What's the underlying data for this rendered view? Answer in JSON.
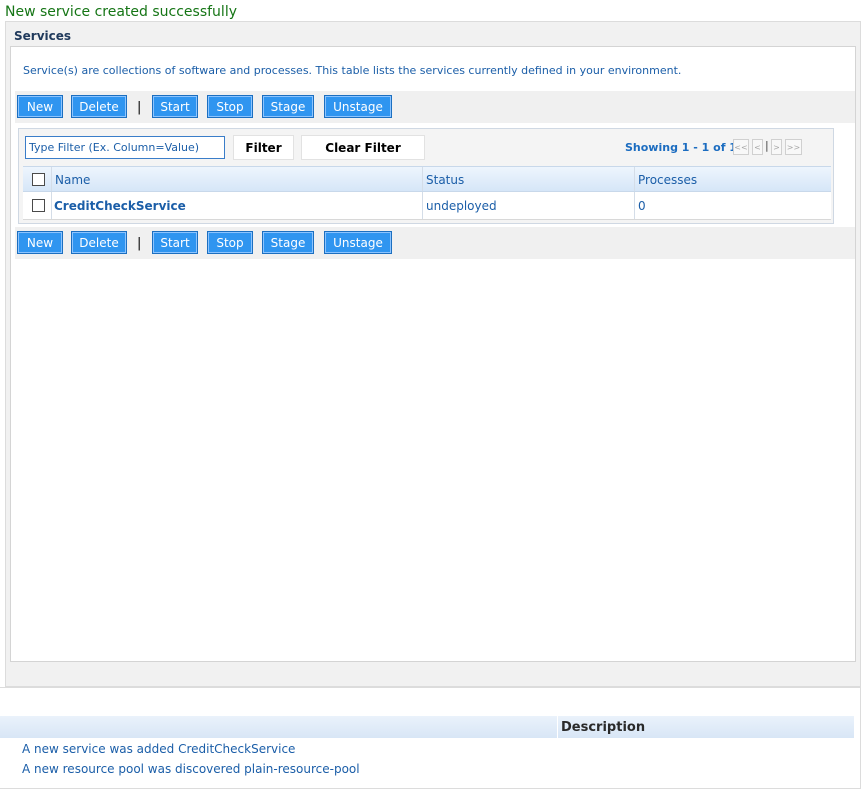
{
  "notification": "New service created successfully",
  "panel": {
    "title": "Services",
    "description": "Service(s) are collections of software and processes. This table lists the services currently defined in your environment."
  },
  "toolbar": {
    "new": "New",
    "delete": "Delete",
    "separator": "|",
    "start": "Start",
    "stop": "Stop",
    "stage": "Stage",
    "unstage": "Unstage"
  },
  "filter": {
    "placeholder": "Type Filter (Ex. Column=Value)",
    "filter_label": "Filter",
    "clear_label": "Clear Filter"
  },
  "paging": {
    "showing": "Showing 1 - 1 of 1",
    "first": "<<",
    "prev": "<",
    "sep": "|",
    "next": ">",
    "last": ">>"
  },
  "table": {
    "columns": [
      "Name",
      "Status",
      "Processes"
    ],
    "rows": [
      {
        "name": "CreditCheckService",
        "status": "undeployed",
        "processes": "0"
      }
    ]
  },
  "events": {
    "header": "Description",
    "items": [
      "A new service was added CreditCheckService",
      "A new resource pool was discovered plain-resource-pool"
    ]
  },
  "colors": {
    "success": "#157515",
    "button": "#2f95f0",
    "link": "#1b5ea8"
  }
}
